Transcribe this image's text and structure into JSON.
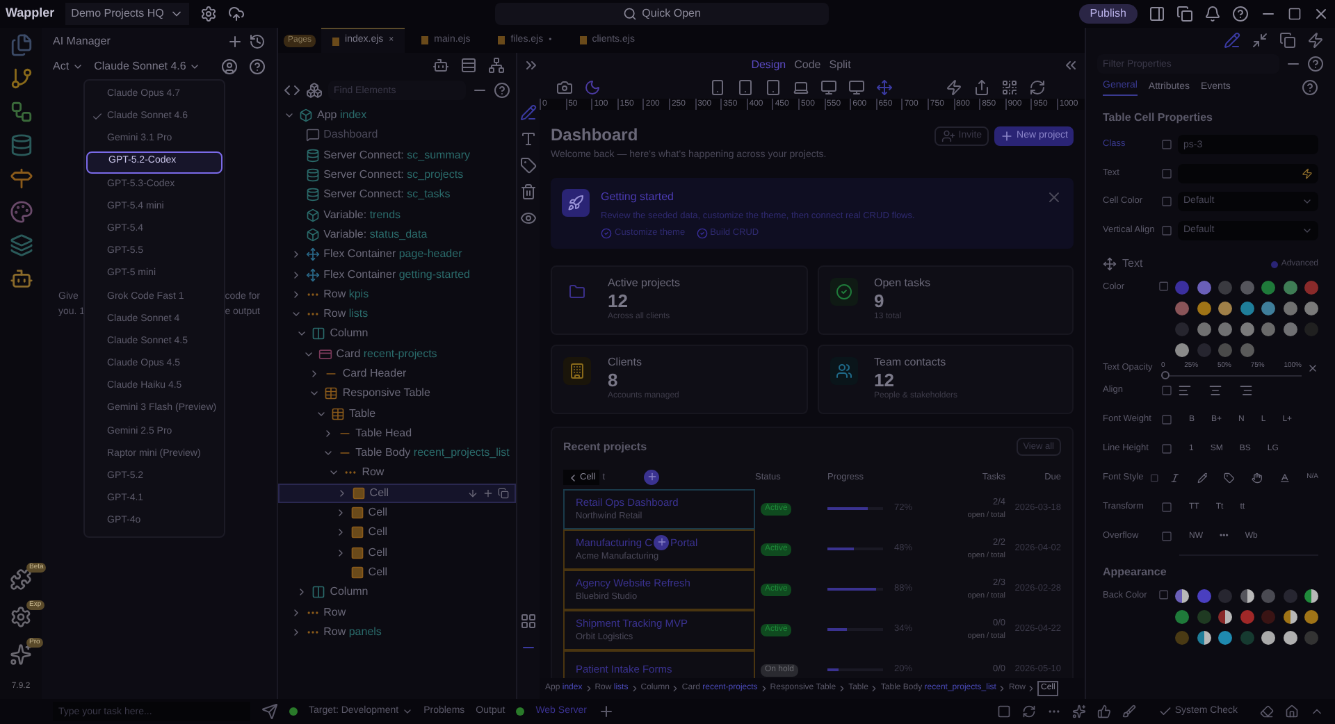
{
  "app": {
    "name": "Wappler",
    "project": "Demo Projects HQ",
    "quick_open": "Quick Open",
    "publish": "Publish",
    "version": "7.9.2"
  },
  "activity_badges": [
    "Beta",
    "Exp",
    "Pro"
  ],
  "ai_manager": {
    "title": "AI Manager",
    "mode": "Act",
    "model": "Claude Sonnet 4.6",
    "hint_left": [
      "Give",
      "you. 1"
    ],
    "hint_right": [
      "code for",
      "e output"
    ],
    "task_placeholder": "Type your task here..."
  },
  "model_menu": [
    {
      "label": "Claude Opus 4.7",
      "checked": false,
      "selected": false
    },
    {
      "label": "Claude Sonnet 4.6",
      "checked": true,
      "selected": false
    },
    {
      "label": "Gemini 3.1 Pro",
      "checked": false,
      "selected": false
    },
    {
      "label": "GPT-5.2-Codex",
      "checked": false,
      "selected": true
    },
    {
      "label": "GPT-5.3-Codex",
      "checked": false,
      "selected": false
    },
    {
      "label": "GPT-5.4 mini",
      "checked": false,
      "selected": false
    },
    {
      "label": "GPT-5.4",
      "checked": false,
      "selected": false
    },
    {
      "label": "GPT-5.5",
      "checked": false,
      "selected": false
    },
    {
      "label": "GPT-5 mini",
      "checked": false,
      "selected": false
    },
    {
      "label": "Grok Code Fast 1",
      "checked": false,
      "selected": false
    },
    {
      "label": "Claude Sonnet 4",
      "checked": false,
      "selected": false
    },
    {
      "label": "Claude Sonnet 4.5",
      "checked": false,
      "selected": false
    },
    {
      "label": "Claude Opus 4.5",
      "checked": false,
      "selected": false
    },
    {
      "label": "Claude Haiku 4.5",
      "checked": false,
      "selected": false
    },
    {
      "label": "Gemini 3 Flash (Preview)",
      "checked": false,
      "selected": false
    },
    {
      "label": "Gemini 2.5 Pro",
      "checked": false,
      "selected": false
    },
    {
      "label": "Raptor mini (Preview)",
      "checked": false,
      "selected": false
    },
    {
      "label": "GPT-5.2",
      "checked": false,
      "selected": false
    },
    {
      "label": "GPT-4.1",
      "checked": false,
      "selected": false
    },
    {
      "label": "GPT-4o",
      "checked": false,
      "selected": false
    }
  ],
  "editor_tabs": {
    "badge": "Pages",
    "tabs": [
      {
        "label": "index.ejs",
        "selected": true,
        "mark": "×"
      },
      {
        "label": "main.ejs",
        "selected": false
      },
      {
        "label": "files.ejs",
        "selected": false,
        "mark": "•"
      },
      {
        "label": "clients.ejs",
        "selected": false
      }
    ]
  },
  "tree": {
    "search_placeholder": "Find Elements",
    "nodes": [
      {
        "label": "App",
        "name": "index",
        "kind": "app",
        "expanded": true,
        "selected": false,
        "children": [
          {
            "label": "Dashboard",
            "kind": "comment",
            "selected": false
          },
          {
            "label": "Server Connect:",
            "name": "sc_summary",
            "kind": "db",
            "selected": false
          },
          {
            "label": "Server Connect:",
            "name": "sc_projects",
            "kind": "db",
            "selected": false
          },
          {
            "label": "Server Connect:",
            "name": "sc_tasks",
            "kind": "db",
            "selected": false
          },
          {
            "label": "Variable:",
            "name": "trends",
            "kind": "var",
            "selected": false
          },
          {
            "label": "Variable:",
            "name": "status_data",
            "kind": "var",
            "selected": false
          },
          {
            "label": "Flex Container",
            "name": "page-header",
            "kind": "move",
            "expanded": false,
            "selected": false
          },
          {
            "label": "Flex Container",
            "name": "getting-started",
            "kind": "move",
            "expanded": false,
            "selected": false
          },
          {
            "label": "Row",
            "name": "kpis",
            "kind": "row",
            "expanded": false,
            "selected": false
          },
          {
            "label": "Row",
            "name": "lists",
            "kind": "row",
            "expanded": true,
            "selected": false,
            "children": [
              {
                "label": "Column",
                "kind": "column",
                "expanded": true,
                "selected": false,
                "children": [
                  {
                    "label": "Card",
                    "name": "recent-projects",
                    "kind": "card",
                    "expanded": true,
                    "selected": false,
                    "children": [
                      {
                        "label": "Card Header",
                        "kind": "header",
                        "expanded": false,
                        "selected": false
                      },
                      {
                        "label": "Responsive Table",
                        "kind": "table",
                        "expanded": true,
                        "selected": false,
                        "children": [
                          {
                            "label": "Table",
                            "kind": "table",
                            "expanded": true,
                            "selected": false,
                            "children": [
                              {
                                "label": "Table Head",
                                "kind": "header",
                                "expanded": false,
                                "selected": false
                              },
                              {
                                "label": "Table Body",
                                "name": "recent_projects_list",
                                "kind": "header",
                                "expanded": true,
                                "selected": false,
                                "children": [
                                  {
                                    "label": "Row",
                                    "kind": "row",
                                    "expanded": true,
                                    "selected": false,
                                    "children": [
                                      {
                                        "label": "Cell",
                                        "kind": "cell",
                                        "expanded": false,
                                        "selected": true
                                      },
                                      {
                                        "label": "Cell",
                                        "kind": "cell",
                                        "expanded": false,
                                        "selected": false
                                      },
                                      {
                                        "label": "Cell",
                                        "kind": "cell",
                                        "expanded": false,
                                        "selected": false
                                      },
                                      {
                                        "label": "Cell",
                                        "kind": "cell",
                                        "expanded": false,
                                        "selected": false
                                      },
                                      {
                                        "label": "Cell",
                                        "kind": "cell",
                                        "selected": false
                                      }
                                    ]
                                  }
                                ]
                              }
                            ]
                          }
                        ]
                      }
                    ]
                  }
                ]
              },
              {
                "label": "Column",
                "kind": "column",
                "expanded": false,
                "selected": false
              }
            ]
          },
          {
            "label": "Row",
            "kind": "row",
            "expanded": false,
            "selected": false
          },
          {
            "label": "Row",
            "name": "panels",
            "kind": "row",
            "expanded": false,
            "selected": false
          }
        ]
      }
    ]
  },
  "view_modes": [
    {
      "label": "Design",
      "selected": true
    },
    {
      "label": "Code",
      "selected": false
    },
    {
      "label": "Split",
      "selected": false
    }
  ],
  "ruler": [
    "0",
    "50",
    "100",
    "150",
    "200",
    "250",
    "300",
    "350",
    "400",
    "450",
    "500",
    "550",
    "600",
    "650",
    "700",
    "750",
    "800",
    "850",
    "900",
    "950",
    "1000"
  ],
  "dashboard": {
    "title": "Dashboard",
    "subtitle": "Welcome back — here's what's happening across your projects.",
    "invite": "Invite",
    "new_project": "New project",
    "banner": {
      "title": "Getting started",
      "text": "Review the seeded data, customize the theme, then connect real CRUD flows.",
      "links": [
        "Customize theme",
        "Build CRUD"
      ]
    },
    "kpis": [
      {
        "kind": "folder",
        "label": "Active projects",
        "value": "12",
        "note": "Across all clients"
      },
      {
        "kind": "check",
        "label": "Open tasks",
        "value": "9",
        "note": "13 total"
      },
      {
        "kind": "building",
        "label": "Clients",
        "value": "8",
        "note": "Accounts managed"
      },
      {
        "kind": "people",
        "label": "Team contacts",
        "value": "12",
        "note": "People & stakeholders"
      }
    ],
    "recent": {
      "title": "Recent projects",
      "view_all": "View all",
      "cell_tag": "Cell",
      "columns": [
        "t",
        "Status",
        "Progress",
        "Tasks",
        "Due"
      ],
      "rows": [
        {
          "name": [
            "Retail Ops Dashboard"
          ],
          "client": "Northwind Retail",
          "status": "Active",
          "kind": "active",
          "level": 0.72,
          "percent": "72%",
          "tasks": "2/4",
          "tasks_note": "open / total",
          "due": "2026-03-18"
        },
        {
          "name": [
            "Manufacturing C",
            "Portal"
          ],
          "client": "Acme Manufacturing",
          "status": "Active",
          "kind": "active",
          "level": 0.48,
          "percent": "48%",
          "tasks": "2/2",
          "tasks_note": "open / total",
          "due": "2026-04-02"
        },
        {
          "name": [
            "Agency Website Refresh"
          ],
          "client": "Bluebird Studio",
          "status": "Active",
          "kind": "active",
          "level": 0.88,
          "percent": "88%",
          "tasks": "2/3",
          "tasks_note": "open / total",
          "due": "2026-02-28"
        },
        {
          "name": [
            "Shipment Tracking MVP"
          ],
          "client": "Orbit Logistics",
          "status": "Active",
          "kind": "active",
          "level": 0.34,
          "percent": "34%",
          "tasks": "0/0",
          "tasks_note": "open / total",
          "due": "2026-04-22"
        },
        {
          "name": [
            "Patient Intake Forms"
          ],
          "status": "On hold",
          "kind": "hold",
          "level": 0.2,
          "percent": "20%",
          "tasks": "0/0",
          "due": "2026-05-10"
        }
      ]
    }
  },
  "breadcrumb": [
    {
      "label": "App",
      "name": "index"
    },
    {
      "label": "Row",
      "name": "lists"
    },
    {
      "label": "Column"
    },
    {
      "label": "Card",
      "name": "recent-projects"
    },
    {
      "label": "Responsive Table"
    },
    {
      "label": "Table"
    },
    {
      "label": "Table Body",
      "name": "recent_projects_list"
    },
    {
      "label": "Row"
    },
    {
      "label": "Cell",
      "selected": true
    }
  ],
  "properties": {
    "filter_placeholder": "Filter Properties",
    "tabs": [
      {
        "label": "General",
        "selected": true
      },
      {
        "label": "Attributes",
        "selected": false
      },
      {
        "label": "Events",
        "selected": false
      }
    ],
    "title": "Table Cell Properties",
    "fields": [
      {
        "label": "Class",
        "kind": "text",
        "value": "ps-3"
      },
      {
        "label": "Text",
        "kind": "dynamic"
      },
      {
        "label": "Cell Color",
        "kind": "select",
        "value": "Default"
      },
      {
        "label": "Vertical Align",
        "kind": "select",
        "value": "Default"
      }
    ],
    "text_section": "Text",
    "advanced": {
      "label": "Advanced",
      "on": false
    },
    "color_label": "Color",
    "text_colors": [
      [
        {
          "color": "#3b2f9e"
        },
        {
          "color": "#6a5fb8"
        },
        {
          "color": "#3a3a40"
        },
        {
          "color": "#55555c"
        },
        {
          "color": "#1f7a3a"
        },
        {
          "color": "#3f7d55"
        },
        {
          "color": "#8a2a2a"
        }
      ],
      [
        {
          "color": "#8a5458"
        },
        {
          "color": "#a07416"
        },
        {
          "color": "#a08048"
        },
        {
          "color": "#1f7e9a"
        },
        {
          "color": "#3f7e9a"
        },
        {
          "color": "#707070"
        },
        {
          "color": "#7a7a7a"
        }
      ],
      [
        {
          "color": "#26252e"
        },
        {
          "color": "#707071"
        },
        {
          "color": "#707072"
        },
        {
          "color": "#7a7a7b"
        },
        {
          "color": "#6a6a6a"
        },
        {
          "color": "#707073"
        },
        {
          "color": "#202020"
        }
      ],
      [
        {
          "color": "#8a8a8a"
        },
        {
          "color": "#26252f"
        },
        {
          "color": "#4a4a4a"
        },
        {
          "color": "#5a5a5a"
        }
      ]
    ],
    "opacity": {
      "label": "Text Opacity",
      "level": 0,
      "ticks": [
        "0",
        "25%",
        "50%",
        "75%",
        "100%"
      ]
    },
    "align_label": "Align",
    "option_rows": [
      {
        "label": "Font Weight",
        "options": [
          "B",
          "B+",
          "N",
          "L",
          "L+"
        ]
      },
      {
        "label": "Line Height",
        "options": [
          "1",
          "SM",
          "BS",
          "LG"
        ]
      }
    ],
    "font_style": {
      "label": "Font Style",
      "none": "N/A"
    },
    "option_rows2": [
      {
        "label": "Transform",
        "options": [
          "TT",
          "Tt",
          "tt"
        ]
      },
      {
        "label": "Overflow",
        "options": [
          "NW",
          "•••",
          "Wb"
        ]
      }
    ],
    "appearance": "Appearance",
    "back_color_label": "Back Color",
    "back_colors": [
      [
        {
          "kind": "half",
          "color": "#6a5fb8"
        },
        {
          "color": "#4a3fc0"
        },
        {
          "color": "#272630"
        },
        {
          "kind": "half",
          "color": "#55555c"
        },
        {
          "color": "#4a4a52"
        },
        {
          "color": "#272631"
        },
        {
          "kind": "half",
          "color": "#1f8a3a"
        }
      ],
      [
        {
          "color": "#1f7a3a"
        },
        {
          "color": "#1f3a22"
        },
        {
          "kind": "half",
          "color": "#8a2a2a"
        },
        {
          "color": "#a02828"
        },
        {
          "color": "#3a1414"
        },
        {
          "kind": "half",
          "color": "#a07416"
        },
        {
          "color": "#a07417"
        }
      ],
      [
        {
          "color": "#4a3a14"
        },
        {
          "kind": "half",
          "color": "#1f7e9a"
        },
        {
          "color": "#1f8ab0"
        },
        {
          "color": "#163a30"
        },
        {
          "color": "#aaaaaa"
        },
        {
          "color": "#b0b0b0"
        },
        {
          "color": "#333333"
        }
      ]
    ]
  },
  "status_bar": {
    "target": "Target: Development",
    "problems": "Problems",
    "output": "Output",
    "web_server": "Web Server",
    "system_check": "System Check"
  }
}
